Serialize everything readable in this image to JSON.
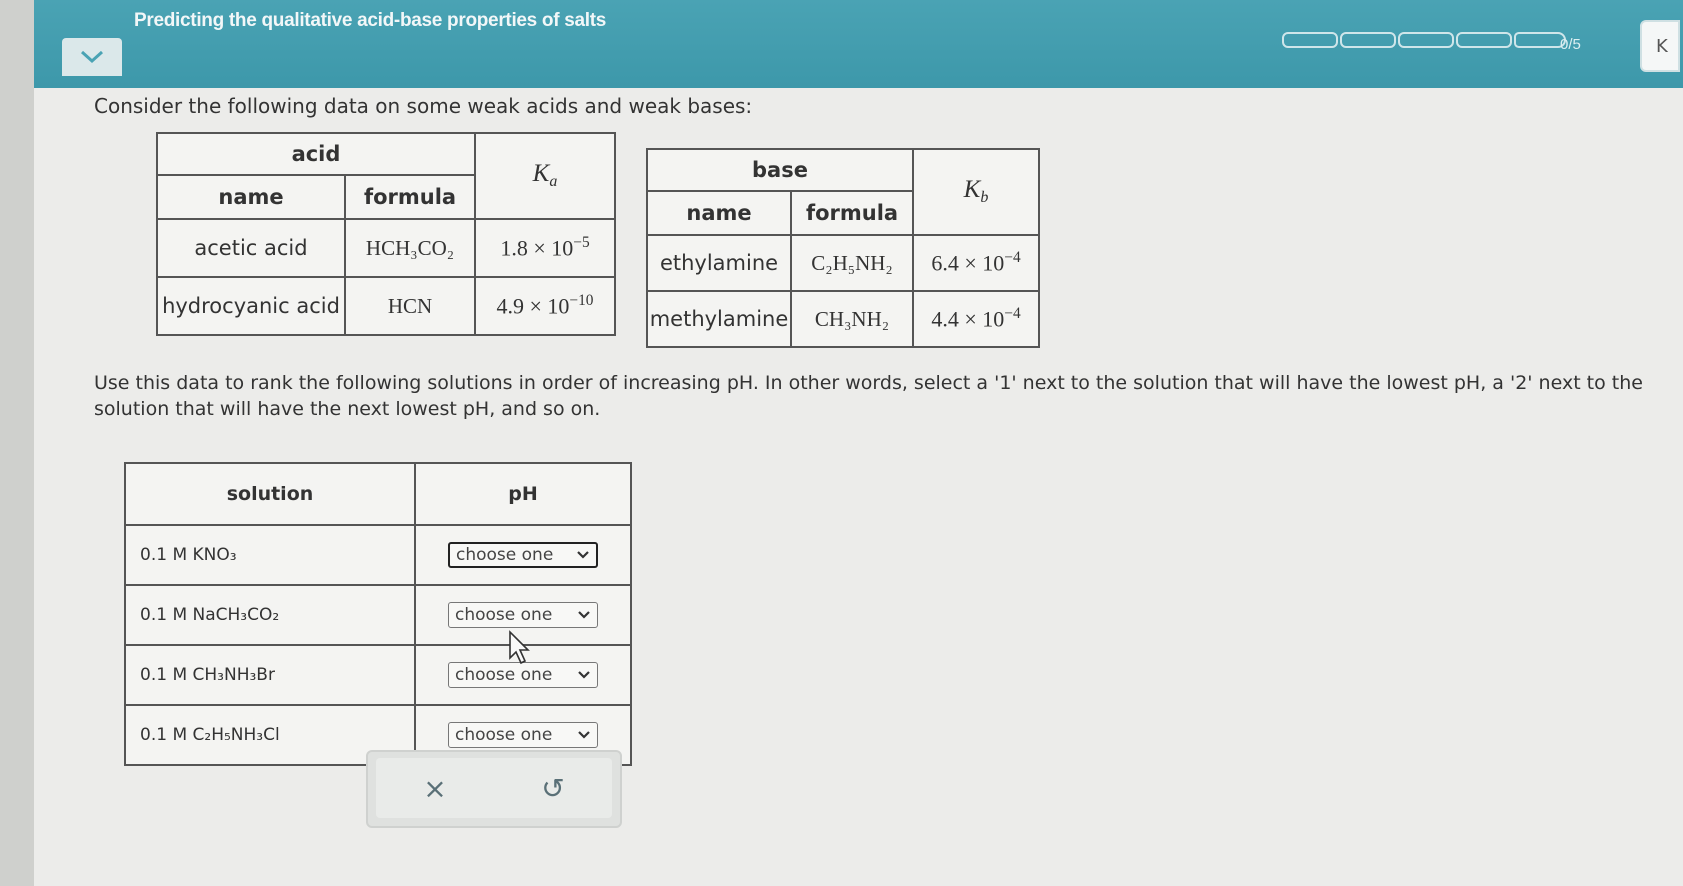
{
  "header": {
    "title": "Predicting the qualitative acid-base properties of salts",
    "progress_text": "0/5",
    "corner_label": "K"
  },
  "intro": "Consider the following data on some weak acids and weak bases:",
  "acid_table": {
    "group_header": "acid",
    "col_name": "name",
    "col_formula": "formula",
    "col_k": "K",
    "col_k_sub": "a",
    "rows": [
      {
        "name": "acetic acid",
        "formula": "HCH₃CO₂",
        "mantissa": "1.8 × 10",
        "exponent": "−5"
      },
      {
        "name": "hydrocyanic acid",
        "formula": "HCN",
        "mantissa": "4.9 × 10",
        "exponent": "−10"
      }
    ]
  },
  "base_table": {
    "group_header": "base",
    "col_name": "name",
    "col_formula": "formula",
    "col_k": "K",
    "col_k_sub": "b",
    "rows": [
      {
        "name": "ethylamine",
        "formula": "C₂H₅NH₂",
        "mantissa": "6.4 × 10",
        "exponent": "−4"
      },
      {
        "name": "methylamine",
        "formula": "CH₃NH₂",
        "mantissa": "4.4 × 10",
        "exponent": "−4"
      }
    ]
  },
  "instructions": "Use this data to rank the following solutions in order of increasing pH. In other words, select a '1' next to the solution that will have the lowest pH, a '2' next to the solution that will have the next lowest pH, and so on.",
  "solution_table": {
    "col_solution": "solution",
    "col_ph": "pH",
    "rows": [
      {
        "solution": "0.1 M KNO₃",
        "select": "choose one"
      },
      {
        "solution": "0.1 M NaCH₃CO₂",
        "select": "choose one"
      },
      {
        "solution": "0.1 M CH₃NH₃Br",
        "select": "choose one"
      },
      {
        "solution": "0.1 M C₂H₅NH₃Cl",
        "select": "choose one"
      }
    ]
  },
  "actions": {
    "clear_symbol": "×",
    "undo_symbol": "↺"
  }
}
